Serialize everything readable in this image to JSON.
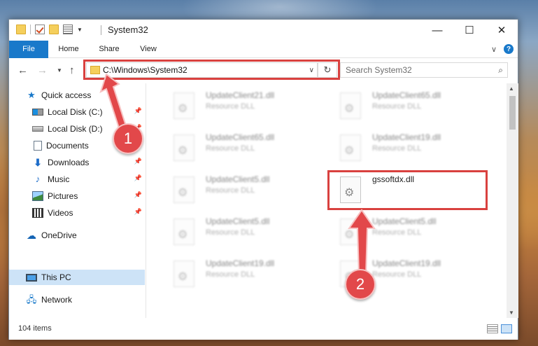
{
  "window": {
    "title": "System32",
    "controls": {
      "minimize": "—",
      "maximize": "☐",
      "close": "✕"
    }
  },
  "ribbon": {
    "tabs": [
      "File",
      "Home",
      "Share",
      "View"
    ],
    "expand_icon": "chevron-down-icon",
    "help_label": "?"
  },
  "address": {
    "path": "C:\\Windows\\System32",
    "search_placeholder": "Search System32"
  },
  "sidebar": {
    "items": [
      {
        "label": "Quick access",
        "icon": "star-icon",
        "pinned": false
      },
      {
        "label": "Local Disk (C:)",
        "icon": "drive-c-icon",
        "pinned": true
      },
      {
        "label": "Local Disk (D:)",
        "icon": "drive-icon",
        "pinned": true
      },
      {
        "label": "Documents",
        "icon": "documents-icon",
        "pinned": true
      },
      {
        "label": "Downloads",
        "icon": "downloads-icon",
        "pinned": true
      },
      {
        "label": "Music",
        "icon": "music-icon",
        "pinned": true
      },
      {
        "label": "Pictures",
        "icon": "pictures-icon",
        "pinned": true
      },
      {
        "label": "Videos",
        "icon": "videos-icon",
        "pinned": true
      },
      {
        "label": "OneDrive",
        "icon": "onedrive-icon",
        "pinned": false
      },
      {
        "label": "This PC",
        "icon": "this-pc-icon",
        "pinned": false,
        "selected": true
      },
      {
        "label": "Network",
        "icon": "network-icon",
        "pinned": false
      }
    ]
  },
  "files": [
    {
      "name": "UpdateClient21.dll",
      "type": "Resource DLL"
    },
    {
      "name": "UpdateClient65.dll",
      "type": "Resource DLL"
    },
    {
      "name": "UpdateClient65.dll",
      "type": "Resource DLL"
    },
    {
      "name": "UpdateClient19.dll",
      "type": "Resource DLL"
    },
    {
      "name": "UpdateClient5.dll",
      "type": "Resource DLL"
    },
    {
      "name": "gssoftdx.dll",
      "type": "",
      "highlighted": true
    },
    {
      "name": "UpdateClient5.dll",
      "type": "Resource DLL"
    },
    {
      "name": "UpdateClient5.dll",
      "type": "Resource DLL"
    },
    {
      "name": "UpdateClient19.dll",
      "type": "Resource DLL"
    },
    {
      "name": "UpdateClient19.dll",
      "type": "Resource DLL"
    }
  ],
  "status": {
    "item_count": "104 items"
  },
  "annotations": {
    "step1": "1",
    "step2": "2",
    "highlight_color": "#d9413f",
    "badge_color": "#e2484a"
  },
  "colors": {
    "accent": "#1979ca",
    "selection": "#cde3f7"
  }
}
